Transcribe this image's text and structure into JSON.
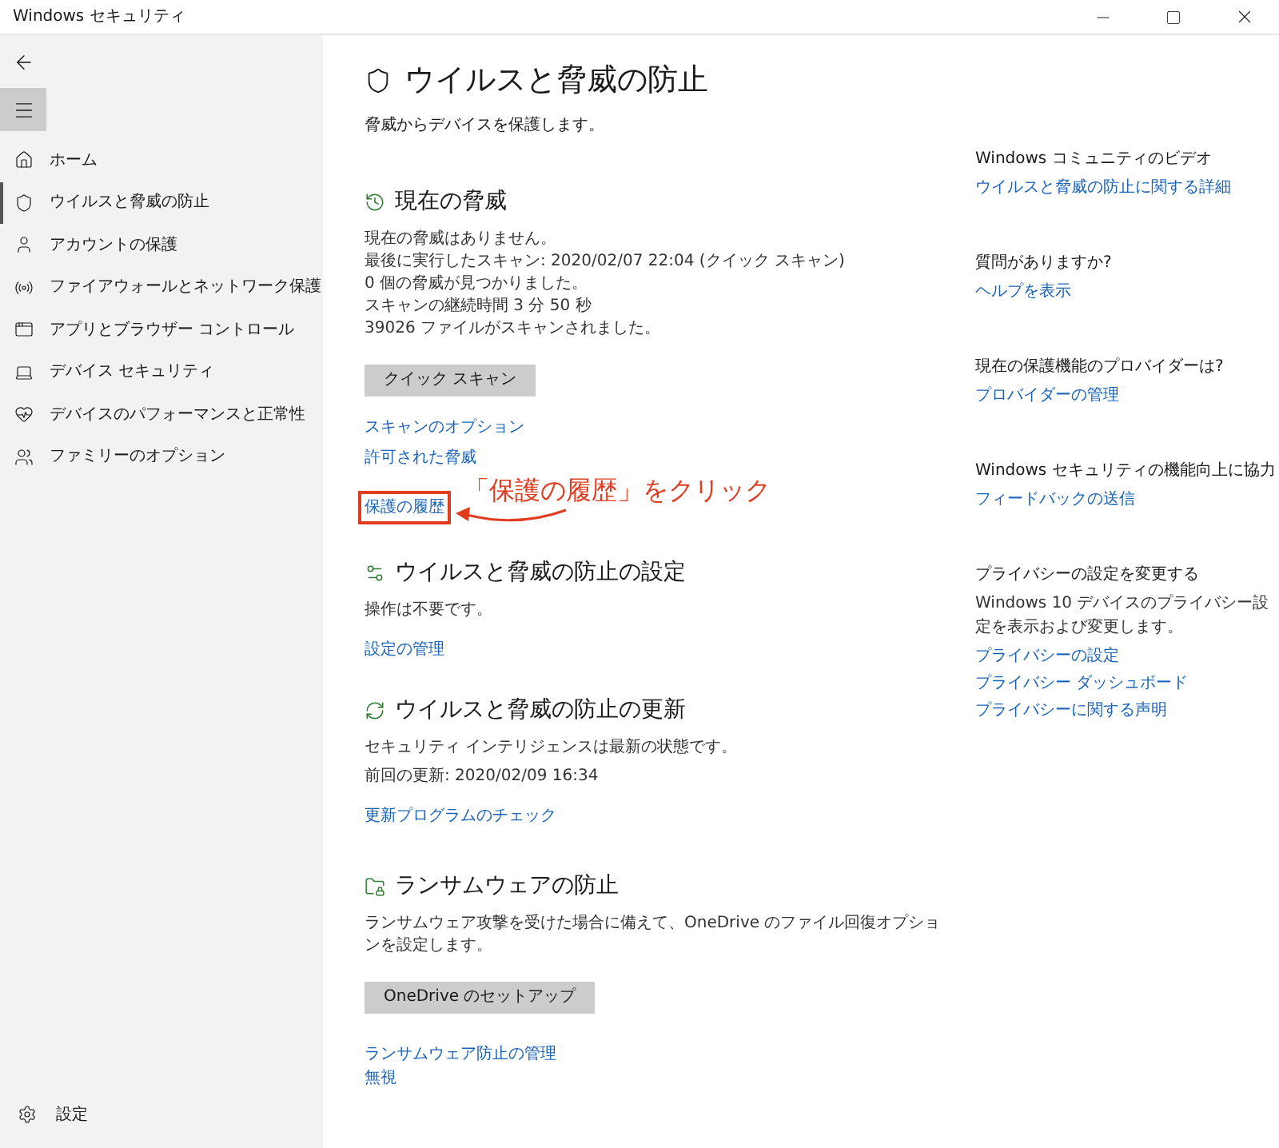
{
  "window": {
    "title": "Windows セキュリティ"
  },
  "sidebar": {
    "items": [
      {
        "kind": "home",
        "label": "ホーム",
        "selected": false
      },
      {
        "kind": "shield",
        "label": "ウイルスと脅威の防止",
        "selected": true
      },
      {
        "kind": "account",
        "label": "アカウントの保護",
        "selected": false
      },
      {
        "kind": "network",
        "label": "ファイアウォールとネットワーク保護",
        "selected": false
      },
      {
        "kind": "app",
        "label": "アプリとブラウザー コントロール",
        "selected": false
      },
      {
        "kind": "device",
        "label": "デバイス セキュリティ",
        "selected": false
      },
      {
        "kind": "health",
        "label": "デバイスのパフォーマンスと正常性",
        "selected": false
      },
      {
        "kind": "family",
        "label": "ファミリーのオプション",
        "selected": false
      }
    ],
    "settings": "設定"
  },
  "page": {
    "title": "ウイルスと脅威の防止",
    "subtitle": "脅威からデバイスを保護します。"
  },
  "sections": [
    {
      "kind": "threats",
      "title": "現在の脅威",
      "lines": [
        "現在の脅威はありません。",
        "最後に実行したスキャン: 2020/02/07 22:04 (クイック スキャン)",
        "0 個の脅威が見つかりました。",
        "スキャンの継続時間 3 分 50 秒",
        "39026 ファイルがスキャンされました。"
      ],
      "button": "クイック スキャン",
      "links": [
        {
          "label": "スキャンのオプション",
          "highlighted": false
        },
        {
          "label": "許可された脅威",
          "highlighted": false
        },
        {
          "label": "保護の履歴",
          "highlighted": true
        }
      ]
    },
    {
      "kind": "settings",
      "title": "ウイルスと脅威の防止の設定",
      "lines": [
        "操作は不要です。"
      ],
      "links": [
        {
          "label": "設定の管理",
          "highlighted": false
        }
      ]
    },
    {
      "kind": "update",
      "title": "ウイルスと脅威の防止の更新",
      "lines": [
        "セキュリティ インテリジェンスは最新の状態です。",
        "前回の更新: 2020/02/09 16:34"
      ],
      "links": [
        {
          "label": "更新プログラムのチェック",
          "highlighted": false
        }
      ]
    },
    {
      "kind": "ransomware",
      "title": "ランサムウェアの防止",
      "lines": [
        "ランサムウェア攻撃を受けた場合に備えて、OneDrive のファイル回復オプションを設定します。"
      ],
      "button": "OneDrive のセットアップ",
      "links": [
        {
          "label": "ランサムウェア防止の管理",
          "highlighted": false
        },
        {
          "label": "無視",
          "highlighted": false
        }
      ]
    }
  ],
  "annotation": {
    "text": "「保護の履歴」をクリック"
  },
  "aside": [
    {
      "heading": "Windows コミュニティのビデオ",
      "links": [
        "ウイルスと脅威の防止に関する詳細"
      ]
    },
    {
      "heading": "質問がありますか?",
      "links": [
        "ヘルプを表示"
      ]
    },
    {
      "heading": "現在の保護機能のプロバイダーは?",
      "links": [
        "プロバイダーの管理"
      ]
    },
    {
      "heading": "Windows セキュリティの機能向上に協力",
      "links": [
        "フィードバックの送信"
      ]
    },
    {
      "heading": "プライバシーの設定を変更する",
      "text": "Windows 10 デバイスのプライバシー設定を表示および変更します。",
      "links": [
        "プライバシーの設定",
        "プライバシー ダッシュボード",
        "プライバシーに関する声明"
      ]
    }
  ]
}
